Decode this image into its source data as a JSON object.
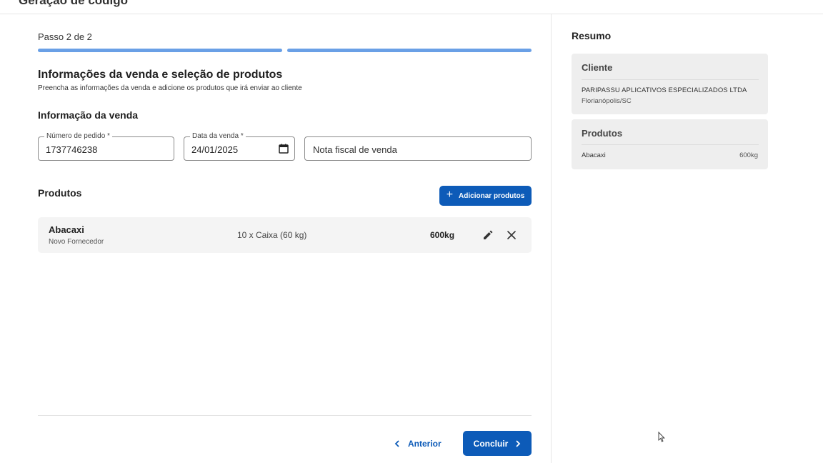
{
  "header": {
    "title": "Geração de código"
  },
  "wizard": {
    "step_label": "Passo 2 de 2",
    "steps_total": 2,
    "steps_completed": 2,
    "progress_color": "#6aa0e6"
  },
  "sale_section": {
    "title": "Informações da venda e seleção de produtos",
    "subtitle": "Preencha as informações da venda e adicione os produtos que irá enviar ao cliente",
    "info_title": "Informação da venda",
    "order_number": {
      "label": "Número de pedido *",
      "value": "1737746238"
    },
    "sale_date": {
      "label": "Data da venda *",
      "value": "24/01/2025",
      "icon": "calendar-icon"
    },
    "invoice": {
      "placeholder": "Nota fiscal de venda",
      "value": ""
    }
  },
  "products_section": {
    "title": "Produtos",
    "add_button_label": "Adicionar produtos",
    "items": [
      {
        "name": "Abacaxi",
        "supplier": "Novo Fornecedor",
        "quantity": "10 x Caixa (60 kg)",
        "weight": "600kg"
      }
    ]
  },
  "footer": {
    "back_label": "Anterior",
    "finish_label": "Concluir"
  },
  "summary": {
    "title": "Resumo",
    "client": {
      "title": "Cliente",
      "name": "PARIPASSU APLICATIVOS ESPECIALIZADOS LTDA",
      "city": "Florianópolis/SC"
    },
    "products": {
      "title": "Produtos",
      "items": [
        {
          "name": "Abacaxi",
          "weight": "600kg"
        }
      ]
    }
  },
  "colors": {
    "primary": "#0d5bb8",
    "card_bg": "#eeeeee",
    "row_bg": "#f4f4f4"
  }
}
